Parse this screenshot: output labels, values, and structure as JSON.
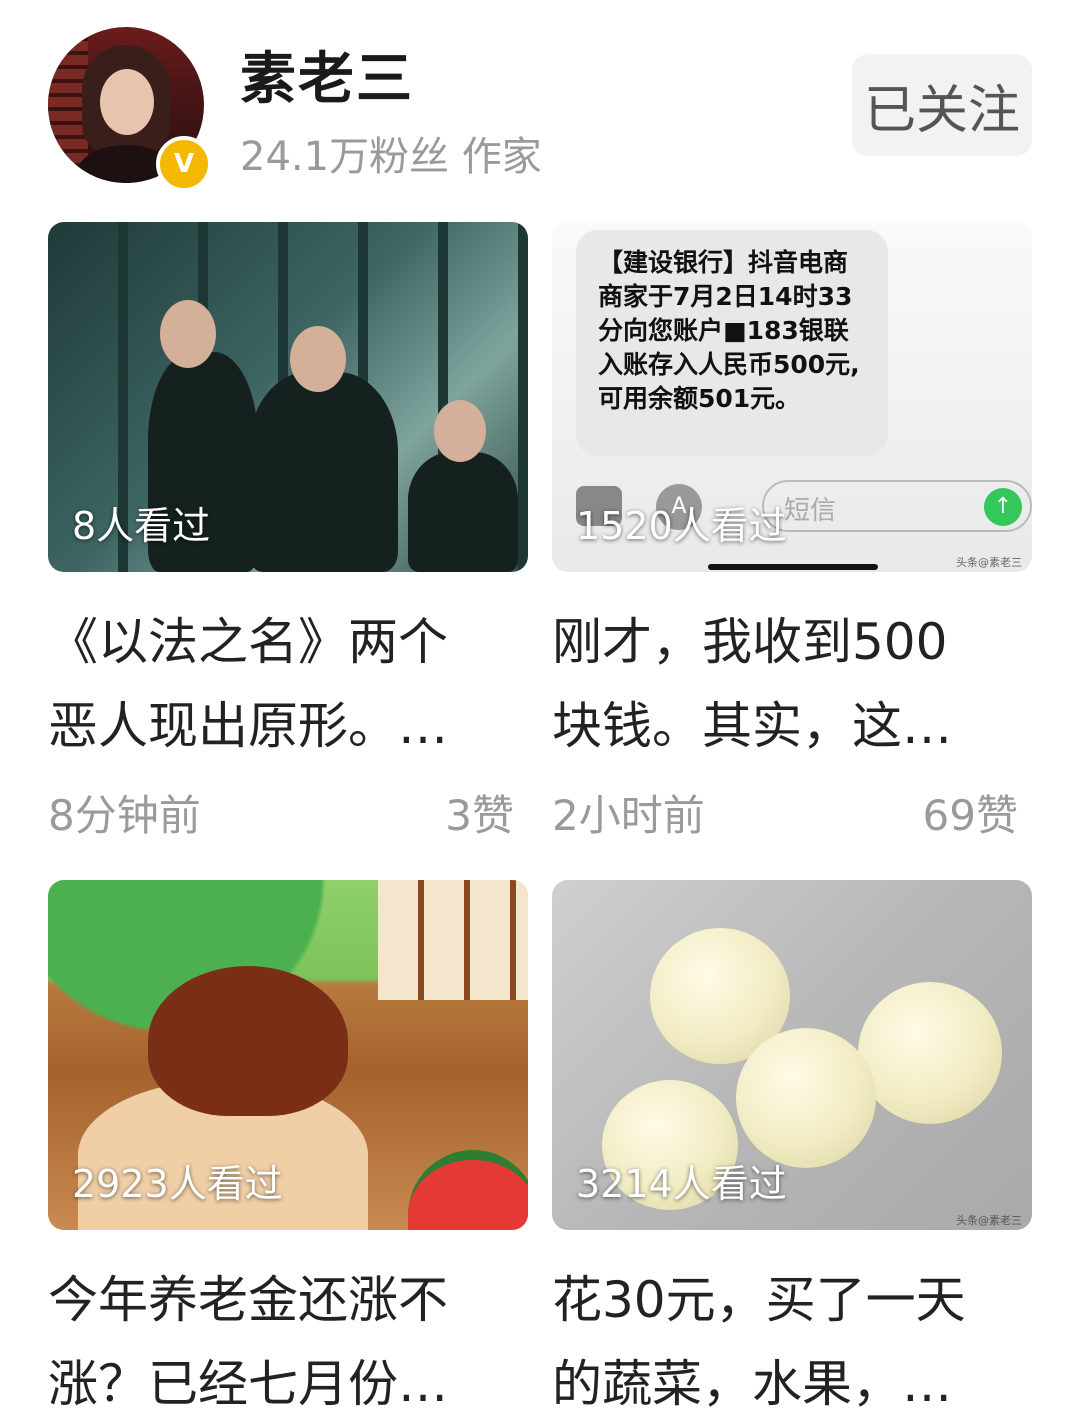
{
  "profile": {
    "name": "素老三",
    "meta": "24.1万粉丝 作家",
    "badge": "V",
    "follow_label": "已关注"
  },
  "cards": [
    {
      "views": "8人看过",
      "title_l1": "《以法之名》两个",
      "title_l2": "恶人现出原形。…",
      "time": "8分钟前",
      "likes": "3赞"
    },
    {
      "views": "1520人看过",
      "title_l1": "刚才，我收到500",
      "title_l2": "块钱。其实，这…",
      "time": "2小时前",
      "likes": "69赞",
      "sms_text": "【建设银行】抖音电商商家于7月2日14时33分向您账户■183银联入账存入人民币500元,可用余额501元。",
      "sms_placeholder": "短信",
      "watermark": "头条@素老三"
    },
    {
      "views": "2923人看过",
      "title_l1": "今年养老金还涨不",
      "title_l2": "涨？已经七月份…"
    },
    {
      "views": "3214人看过",
      "title_l1": "花30元，买了一天",
      "title_l2": "的蔬菜，水果，…",
      "watermark": "头条@素老三"
    }
  ]
}
